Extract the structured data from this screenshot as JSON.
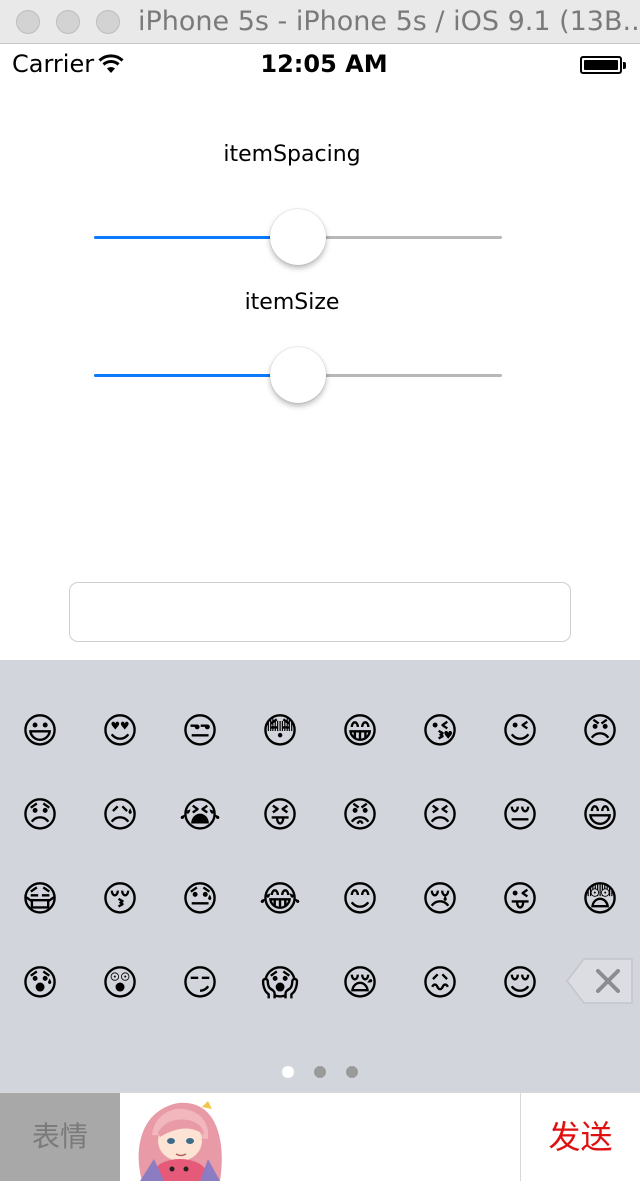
{
  "window": {
    "title": "iPhone 5s - iPhone 5s / iOS 9.1 (13B..."
  },
  "status_bar": {
    "carrier": "Carrier",
    "time": "12:05 AM"
  },
  "controls": {
    "item_spacing": {
      "label": "itemSpacing",
      "value_fraction": 0.5
    },
    "item_size": {
      "label": "itemSize",
      "value_fraction": 0.5
    }
  },
  "text_input": {
    "value": "",
    "placeholder": ""
  },
  "emoji_keyboard": {
    "rows": [
      [
        "😃",
        "😍",
        "😒",
        "😳",
        "😁",
        "😘",
        "😉",
        "😠"
      ],
      [
        "😞",
        "😥",
        "😭",
        "😝",
        "😡",
        "😣",
        "😔",
        "😄"
      ],
      [
        "😷",
        "😚",
        "😓",
        "😂",
        "😊",
        "😢",
        "😜",
        "😨"
      ],
      [
        "😰",
        "😲",
        "😏",
        "😱",
        "😪",
        "😖",
        "😌"
      ]
    ],
    "page_count": 3,
    "current_page": 1
  },
  "bottom_bar": {
    "emoji_tab": "表情",
    "send": "发送"
  },
  "colors": {
    "accent": "#0a7aff",
    "send_text": "#e01010",
    "keyboard_bg": "#d3d5dc"
  }
}
